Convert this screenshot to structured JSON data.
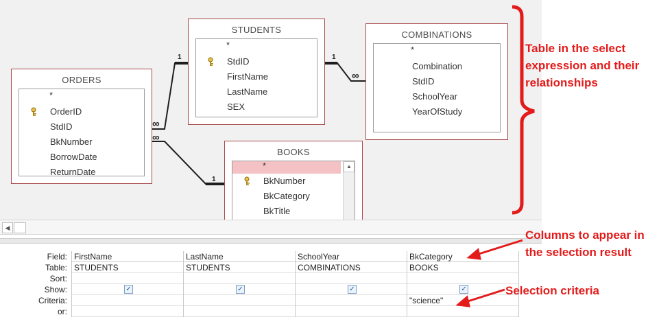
{
  "tables": {
    "orders": {
      "title": "ORDERS",
      "fields": [
        "*",
        "OrderID",
        "StdID",
        "BkNumber",
        "BorrowDate",
        "ReturnDate"
      ],
      "key_field": "OrderID"
    },
    "students": {
      "title": "STUDENTS",
      "fields": [
        "*",
        "StdID",
        "FirstName",
        "LastName",
        "SEX"
      ],
      "key_field": "StdID"
    },
    "combinations": {
      "title": "COMBINATIONS",
      "fields": [
        "*",
        "Combination",
        "StdID",
        "SchoolYear",
        "YearOfStudy"
      ]
    },
    "books": {
      "title": "BOOKS",
      "fields": [
        "*",
        "BkNumber",
        "BkCategory",
        "BkTitle"
      ],
      "key_field": "BkNumber",
      "highlighted": "*"
    }
  },
  "relationships": {
    "one": "1",
    "many": "∞"
  },
  "annotations": {
    "tables_caption": [
      "Table in the select",
      "expression and their",
      "relationships"
    ],
    "columns_caption": [
      "Columns to appear in",
      "the selection result"
    ],
    "criteria_caption": "Selection criteria",
    "color": "#e31b1b"
  },
  "query_grid": {
    "row_labels": [
      "Field:",
      "Table:",
      "Sort:",
      "Show:",
      "Criteria:",
      "or:"
    ],
    "columns": [
      {
        "field": "FirstName",
        "table": "STUDENTS",
        "sort": "",
        "show": true,
        "criteria": "",
        "or": ""
      },
      {
        "field": "LastName",
        "table": "STUDENTS",
        "sort": "",
        "show": true,
        "criteria": "",
        "or": ""
      },
      {
        "field": "SchoolYear",
        "table": "COMBINATIONS",
        "sort": "",
        "show": true,
        "criteria": "",
        "or": ""
      },
      {
        "field": "BkCategory",
        "table": "BOOKS",
        "sort": "",
        "show": true,
        "criteria": "\"science\"",
        "or": ""
      }
    ]
  },
  "icons": {
    "key": "key-icon",
    "scroll_left": "scroll-left-arrow-icon",
    "scroll_up": "scroll-up-arrow-icon"
  }
}
